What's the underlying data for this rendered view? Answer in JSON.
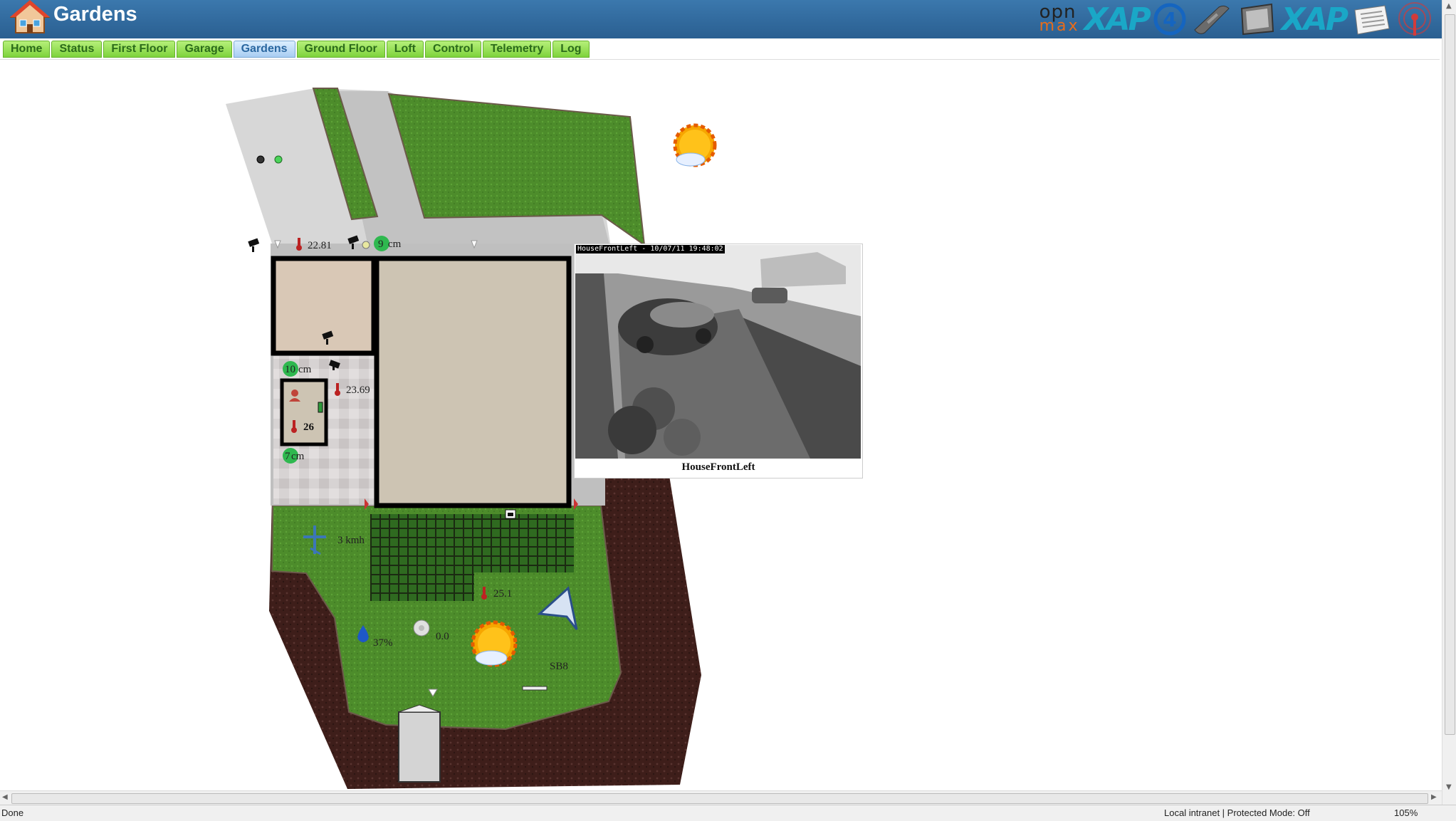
{
  "header": {
    "title": "Gardens"
  },
  "logos": [
    "openmax-logo",
    "xap-logo",
    "channel4-logo",
    "phone-icon",
    "tv-icon",
    "xap-logo",
    "news-icon",
    "broadcast-icon"
  ],
  "logo_text": {
    "open": "opn",
    "max": "max",
    "xap": "XAP",
    "four": "4"
  },
  "nav": {
    "tabs": [
      "Home",
      "Status",
      "First Floor",
      "Garage",
      "Gardens",
      "Ground Floor",
      "Loft",
      "Control",
      "Telemetry",
      "Log"
    ],
    "active": "Gardens"
  },
  "sensors": {
    "temp_front": "22.81",
    "level_front": "9",
    "level_front_unit": "cm",
    "level_side_top": "10",
    "level_side_top_unit": "cm",
    "temp_side": "23.69",
    "temp_room": "26",
    "level_side_bottom": "7",
    "level_side_bottom_unit": "cm",
    "wind_speed": "3 kmh",
    "temp_garden": "25.1",
    "humidity": "37%",
    "rain": "0.0",
    "station": "SB8"
  },
  "camera": {
    "stamp": "HouseFrontLeft - 10/07/11 19:48:02",
    "caption": "HouseFrontLeft"
  },
  "statusbar": {
    "status": "Done",
    "zone": "Local intranet | Protected Mode: Off",
    "zoom": "105%"
  },
  "colors": {
    "header": "#2f6aa0",
    "tab": "#8ddb4a",
    "tab_active": "#bcdcf7",
    "lawn": "#4f8f2c",
    "soil": "#3f1f1b",
    "paving": "#c8c8c8",
    "level_badge": "#2fb84f"
  }
}
